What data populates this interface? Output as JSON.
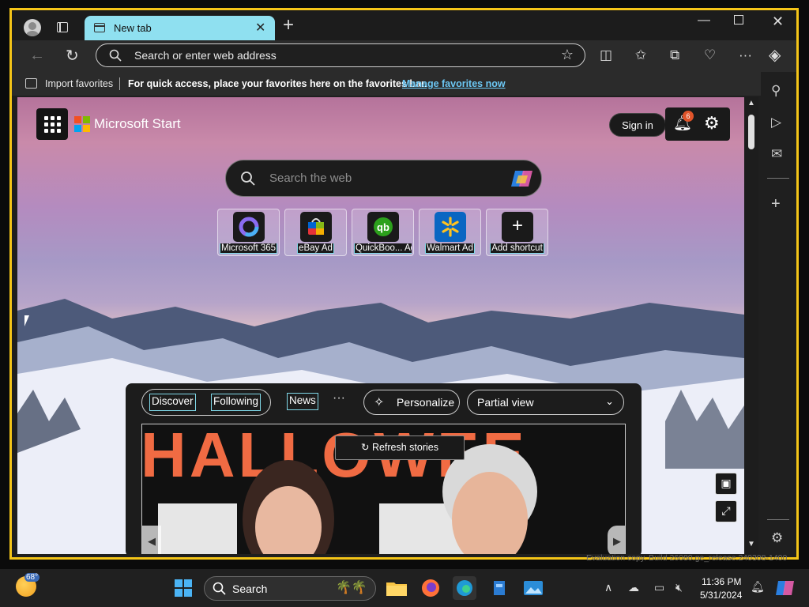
{
  "browser": {
    "tab_title": "New tab",
    "address_placeholder": "Search or enter web address",
    "favorites_bar": {
      "import_label": "Import favorites",
      "hint": "For quick access, place your favorites here on the favorites bar.",
      "manage_link": "Manage favorites now"
    }
  },
  "newtab": {
    "brand": "Microsoft Start",
    "sign_in": "Sign in",
    "notification_count": "6",
    "search_placeholder": "Search the web",
    "shortcuts": [
      {
        "label": "Microsoft 365",
        "icon": "microsoft365-icon"
      },
      {
        "label": "eBay Ad",
        "icon": "ebay-icon"
      },
      {
        "label": "QuickBoo... Ad",
        "icon": "quickbooks-icon"
      },
      {
        "label": "Walmart Ad",
        "icon": "walmart-icon"
      },
      {
        "label": "Add shortcut",
        "icon": "plus-icon"
      }
    ]
  },
  "news": {
    "tab_discover": "Discover",
    "tab_following": "Following",
    "tab_news": "News",
    "more": "···",
    "personalize": "Personalize",
    "view_selected": "Partial view",
    "refresh_stories": "Refresh stories",
    "headline_image_text": "HALLOWEE"
  },
  "desktop": {
    "watermark": "Evaluation copy. Build 26080.ge_release.240308-1400"
  },
  "taskbar": {
    "weather_temp": "68°",
    "search_label": "Search",
    "clock_time": "11:36 PM",
    "clock_date": "5/31/2024"
  },
  "colors": {
    "window_border": "#f5c518",
    "tab_active": "#8fe0f0",
    "link": "#6cc8f5",
    "accent_orange": "#f06b43"
  }
}
